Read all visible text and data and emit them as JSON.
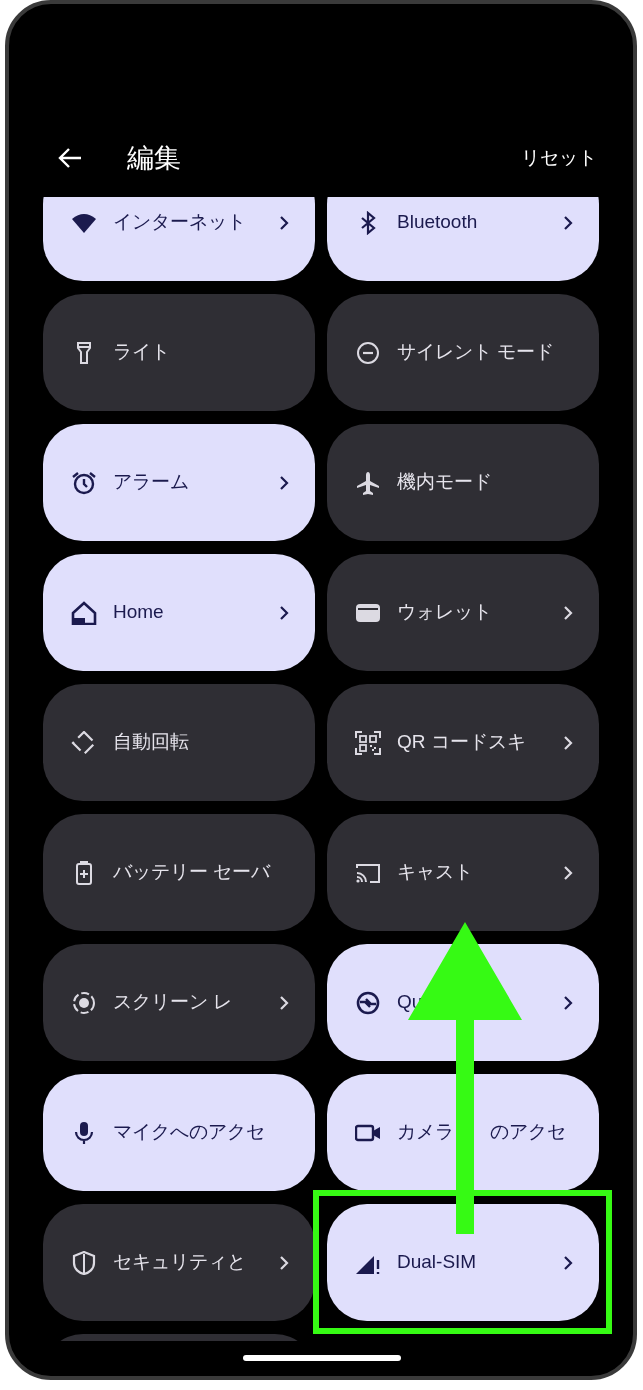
{
  "header": {
    "title": "編集",
    "reset": "リセット"
  },
  "tiles": [
    {
      "kind": "wifi",
      "label": "インターネット",
      "on": true,
      "chevron": true,
      "highlighted": false
    },
    {
      "kind": "bluetooth",
      "label": "Bluetooth",
      "on": true,
      "chevron": true,
      "highlighted": false
    },
    {
      "kind": "flashlight",
      "label": "ライト",
      "on": false,
      "chevron": false,
      "highlighted": false
    },
    {
      "kind": "dnd",
      "label": "サイレント モード",
      "on": false,
      "chevron": false,
      "highlighted": false
    },
    {
      "kind": "alarm",
      "label": "アラーム",
      "on": true,
      "chevron": true,
      "highlighted": false
    },
    {
      "kind": "airplane",
      "label": "機内モード",
      "on": false,
      "chevron": false,
      "highlighted": false
    },
    {
      "kind": "home",
      "label": "Home",
      "on": true,
      "chevron": true,
      "highlighted": false
    },
    {
      "kind": "wallet",
      "label": "ウォレット",
      "on": false,
      "chevron": true,
      "highlighted": false
    },
    {
      "kind": "rotate",
      "label": "自動回転",
      "on": false,
      "chevron": false,
      "highlighted": false
    },
    {
      "kind": "qr",
      "label": "QR コードスキ",
      "on": false,
      "chevron": true,
      "highlighted": false
    },
    {
      "kind": "battery",
      "label": "バッテリー セーバ",
      "on": false,
      "chevron": false,
      "highlighted": false
    },
    {
      "kind": "cast",
      "label": "キャスト",
      "on": false,
      "chevron": true,
      "highlighted": false
    },
    {
      "kind": "record",
      "label": "スクリーン レ",
      "on": false,
      "chevron": true,
      "highlighted": false
    },
    {
      "kind": "share",
      "label": "Qu",
      "on": true,
      "chevron": true,
      "highlighted": false
    },
    {
      "kind": "mic",
      "label": "マイクへのアクセ",
      "on": true,
      "chevron": false,
      "highlighted": false
    },
    {
      "kind": "camera",
      "label": "カメラ",
      "label_after_arrow": "のアクセ",
      "on": true,
      "chevron": false,
      "highlighted": false
    },
    {
      "kind": "shield",
      "label": "セキュリティと",
      "on": false,
      "chevron": true,
      "highlighted": false
    },
    {
      "kind": "signal",
      "label": "Dual-SIM",
      "on": true,
      "chevron": true,
      "highlighted": true
    },
    {
      "kind": "blank",
      "on": false,
      "chevron": false,
      "highlighted": false
    }
  ]
}
